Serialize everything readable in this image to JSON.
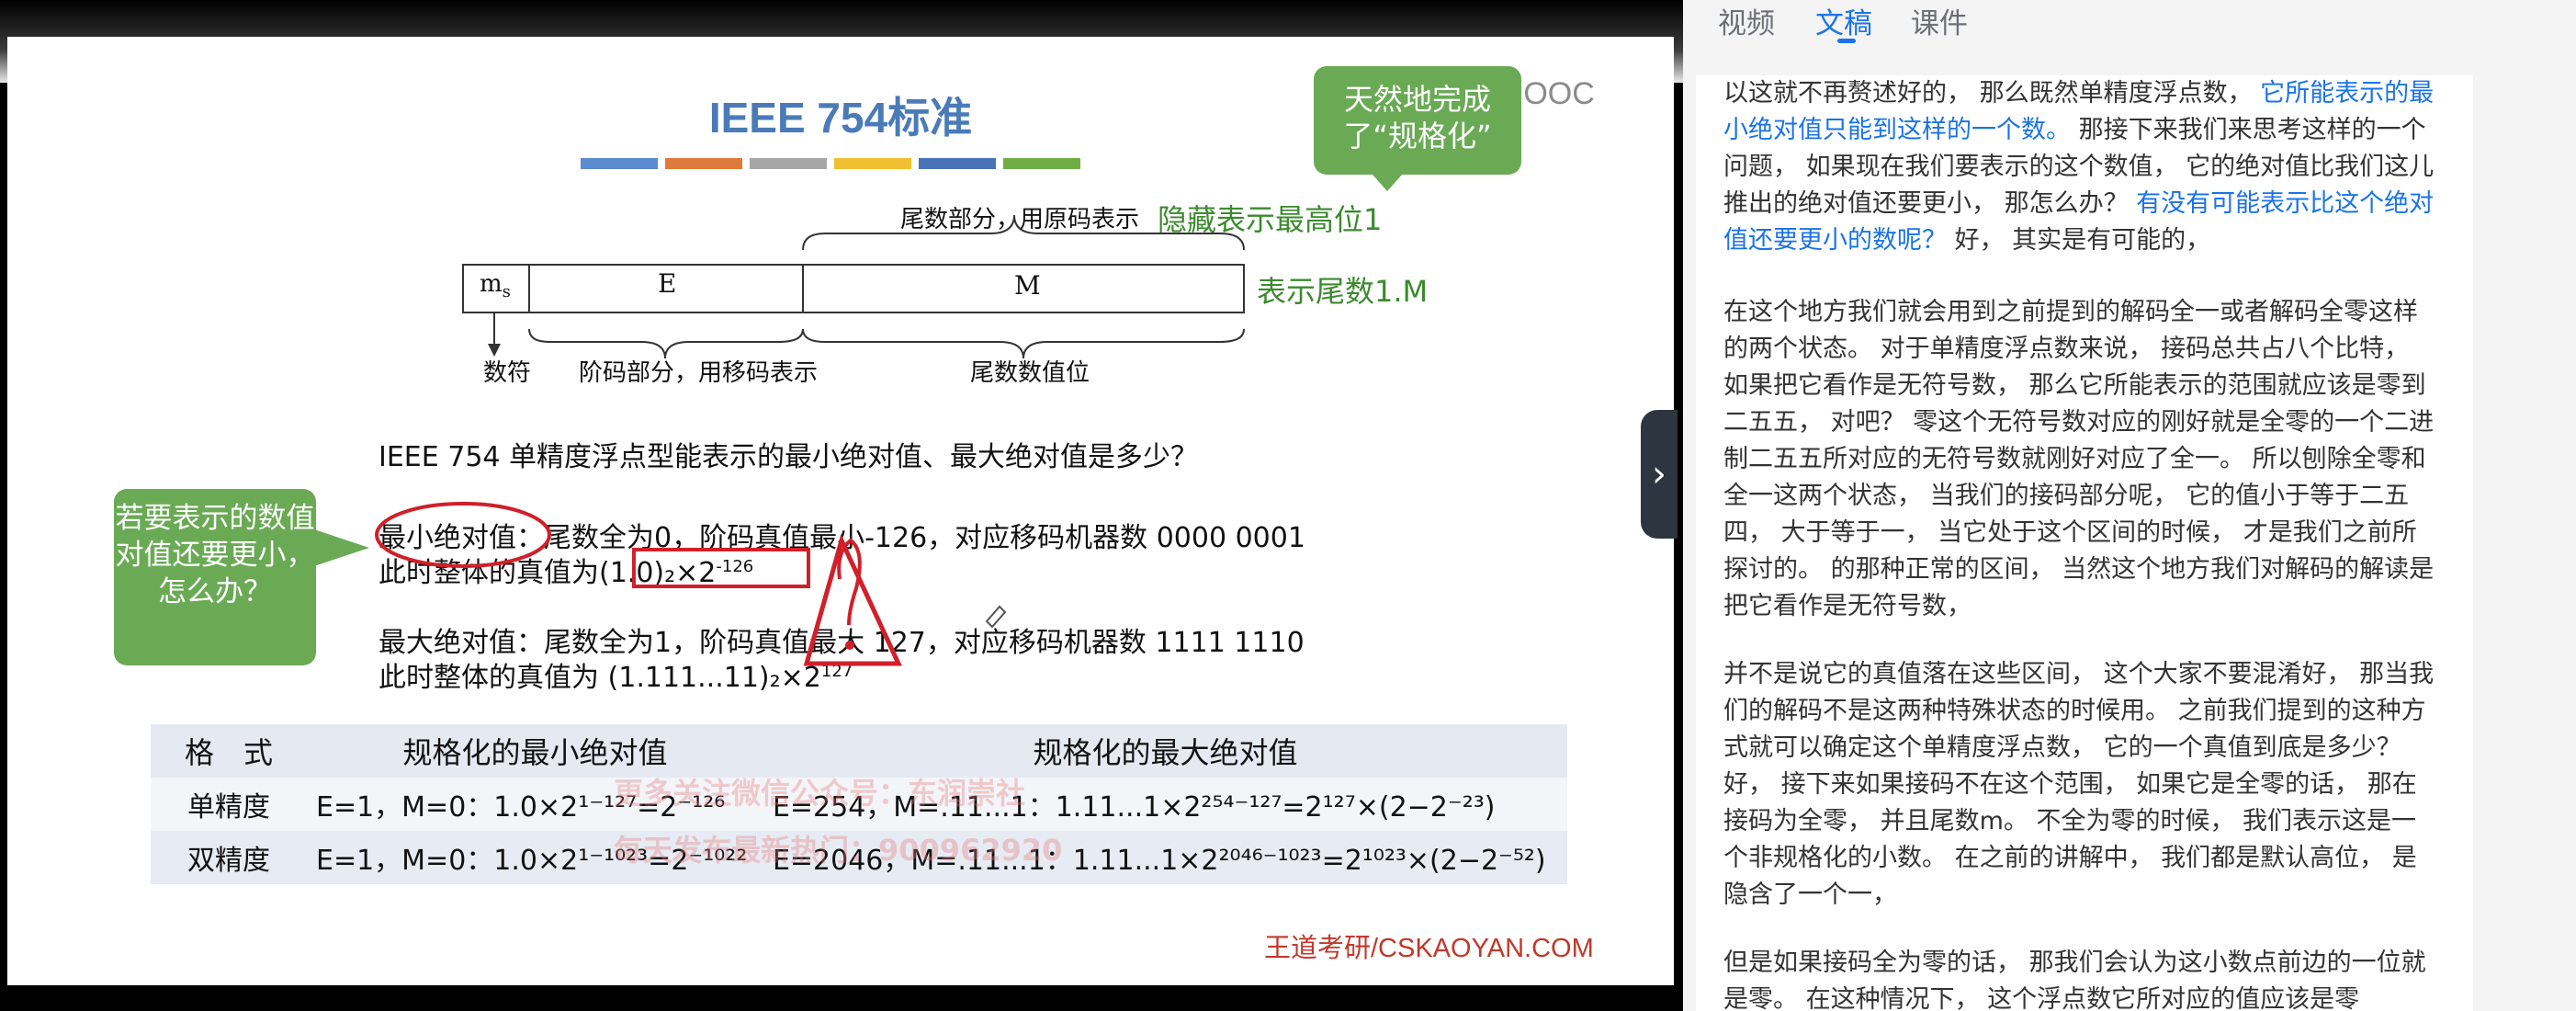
{
  "tabs": [
    "视频",
    "文稿",
    "课件"
  ],
  "slide": {
    "title": "IEEE 754标准",
    "colorbars": [
      "#5b8bd0",
      "#e07a3a",
      "#a6a6a6",
      "#f0c030",
      "#4a72b8",
      "#70ad47"
    ],
    "logo": "中国大学MOOC",
    "tip_top": "天然地完成了“规格化”",
    "tip_left": "若要表示的数值对值还要更小，怎么办？",
    "mantissa_part": "尾数部分，用原码表示",
    "hidden_bit": "隐藏表示最高位1",
    "represent_mantissa": "表示尾数1.M",
    "box_ms": "m",
    "box_ms_sub": "s",
    "box_E": "E",
    "box_M": "M",
    "label_sign": "数符",
    "label_exp": "阶码部分，用移码表示",
    "label_mant": "尾数数值位",
    "question": "IEEE 754 单精度浮点型能表示的最小绝对值、最大绝对值是多少？",
    "min_line1_head": "最小绝对值",
    "min_line1_rest": "：尾数全为0，阶码真值最小-126，对应移码机器数 0000 0001",
    "min_line2_pre": "此时整体的真值为",
    "min_line2_val": "(1.0)₂×2",
    "min_line2_exp": "-126",
    "max_line1": "最大绝对值：尾数全为1，阶码真值最大 127，对应移码机器数 1111 1110",
    "max_line2_pre": "此时整体的真值为 (1.111...11)₂×2",
    "max_line2_exp": "127",
    "table": {
      "headers": [
        "格　式",
        "规格化的最小绝对值",
        "规格化的最大绝对值"
      ],
      "rows": [
        {
          "fmt": "单精度",
          "min": "E=1，M=0：1.0×2¹⁻¹²⁷=2⁻¹²⁶",
          "max": "E=254，M=.11...1：1.11...1×2²⁵⁴⁻¹²⁷=2¹²⁷×(2−2⁻²³)"
        },
        {
          "fmt": "双精度",
          "min": "E=1，M=0：1.0×2¹⁻¹⁰²³=2⁻¹⁰²²",
          "max": "E=2046，M=.11...1：1.11...1×2²⁰⁴⁶⁻¹⁰²³=2¹⁰²³×(2−2⁻⁵²)"
        }
      ]
    },
    "watermark1": "更多关注微信公众号：东润崇社",
    "watermark2": "每天发布最新热门：900962920",
    "brand": "王道考研/CSKAOYAN.COM"
  },
  "transcript": [
    {
      "segments": [
        {
          "t": "以这就不再赘述好的，  那么既然单精度浮点数，  ",
          "hl": false
        },
        {
          "t": "它所能表示的最小绝对值只能到这样的一个数。",
          "hl": true
        },
        {
          "t": "  那接下来我们来思考这样的一个问题，  如果现在我们要表示的这个数值，  它的绝对值比我们这儿推出的绝对值还要更小，  那怎么办？  ",
          "hl": false
        },
        {
          "t": "有没有可能表示比这个绝对值还要更小的数呢？",
          "hl": true
        },
        {
          "t": "  好，  其实是有可能的，",
          "hl": false
        }
      ]
    },
    {
      "segments": [
        {
          "t": "在这个地方我们就会用到之前提到的解码全一或者解码全零这样的两个状态。  对于单精度浮点数来说，  接码总共占八个比特，  如果把它看作是无符号数，  那么它所能表示的范围就应该是零到二五五，  对吧？  零这个无符号数对应的刚好就是全零的一个二进制二五五所对应的无符号数就刚好对应了全一。  所以刨除全零和全一这两个状态，  当我们的接码部分呢，  它的值小于等于二五四，  大于等于一，  当它处于这个区间的时候，  才是我们之前所探讨的。  的那种正常的区间，  当然这个地方我们对解码的解读是把它看作是无符号数，",
          "hl": false
        }
      ]
    },
    {
      "segments": [
        {
          "t": "并不是说它的真值落在这些区间，  这个大家不要混淆好，  那当我们的解码不是这两种特殊状态的时候用。  之前我们提到的这种方式就可以确定这个单精度浮点数，  它的一个真值到底是多少？  好，  接下来如果接码不在这个范围，  如果它是全零的话，  那在接码为全零，  并且尾数m。  不全为零的时候，  我们表示这是一个非规格化的小数。  在之前的讲解中，  我们都是默认高位，  是隐含了一个一，",
          "hl": false
        }
      ]
    },
    {
      "segments": [
        {
          "t": "但是如果接码全为零的话，  那我们会认为这小数点前边的一位就是零。  在这种情况下，  这个浮点数它所对应的值应该是零",
          "hl": false
        }
      ]
    }
  ]
}
